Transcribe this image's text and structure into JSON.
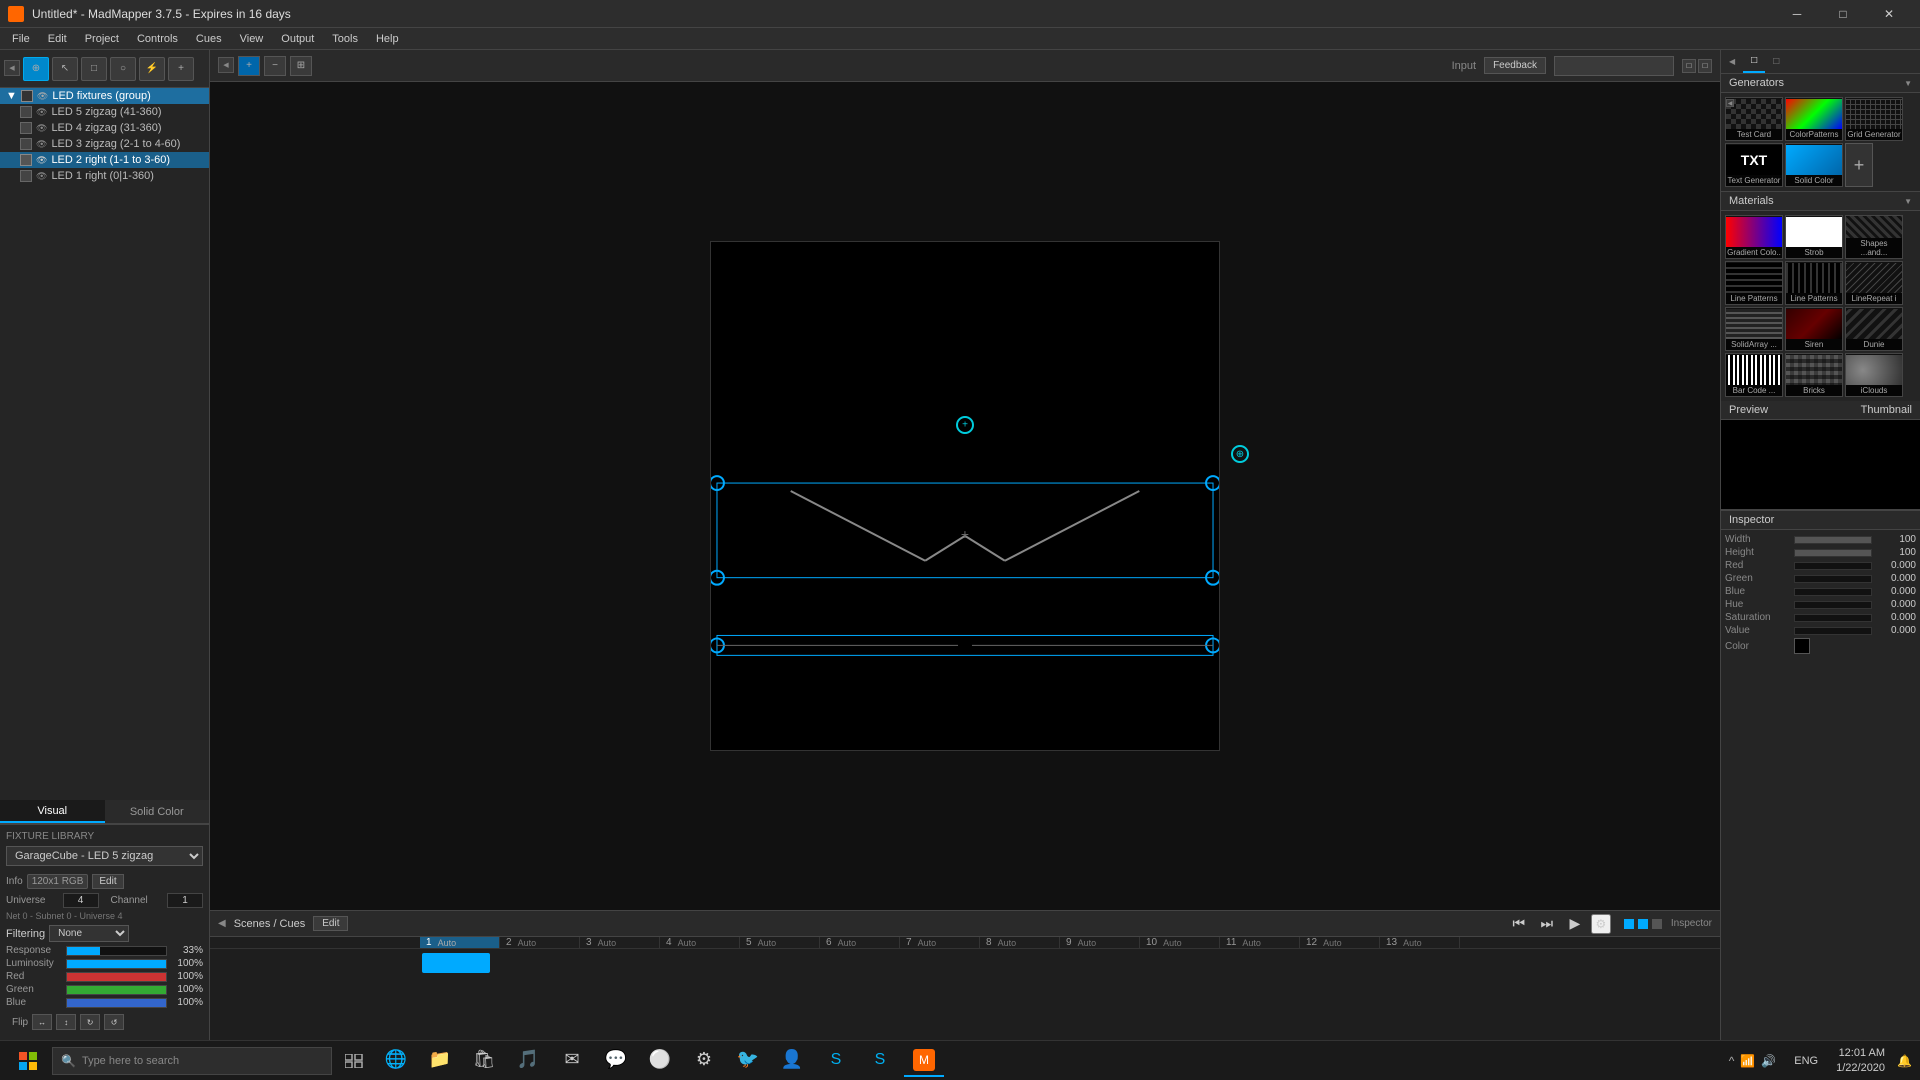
{
  "titlebar": {
    "title": "Untitled* - MadMapper 3.7.5 - Expires in 16 days",
    "icon": "★",
    "min_label": "─",
    "max_label": "□",
    "close_label": "✕"
  },
  "menubar": {
    "items": [
      "File",
      "Edit",
      "Project",
      "Controls",
      "Cues",
      "View",
      "Output",
      "Tools",
      "Help"
    ]
  },
  "toolbar": {
    "buttons": [
      "⚡",
      "□",
      "◎",
      "⚙",
      "⚡"
    ],
    "play_pause": "⏸",
    "stop": "⏹",
    "record": "⏺",
    "refresh": "↻"
  },
  "left_panel": {
    "scene_tree": {
      "group": "LED fixtures (group)",
      "items": [
        {
          "label": "LED 5 zigzag (41-360)",
          "selected": false
        },
        {
          "label": "LED 4 zigzag (31-360)",
          "selected": false
        },
        {
          "label": "LED 3 zigzag (2-1 to 4-60)",
          "selected": false
        },
        {
          "label": "LED 2 right (1-1 to 3-60)",
          "selected": true
        },
        {
          "label": "LED 1 right (0|1-360)",
          "selected": false
        }
      ]
    },
    "visual_tab": "Visual",
    "solid_color_tab": "Solid Color",
    "fixture_library": {
      "title": "Fixture Library",
      "dropdown": "GarageCube - LED 5 zigzag",
      "info_label": "Info",
      "info_value": "120x1 RGB",
      "edit_label": "Edit",
      "universe_label": "Universe",
      "universe_value": "4",
      "channel_label": "Channel",
      "channel_value": "1",
      "net_label": "Net 0 - Subnet 0 - Universe 4",
      "filtering_label": "Filtering",
      "filtering_value": "None",
      "response_label": "Response",
      "response_value": "33%",
      "luminosity_label": "Luminosity",
      "luminosity_value": "100%",
      "red_label": "Red",
      "red_value": "100%",
      "green_label": "Green",
      "green_value": "100%",
      "blue_label": "Blue",
      "blue_value": "100%",
      "flip_label": "Flip"
    }
  },
  "canvas": {
    "bg": "#000000"
  },
  "scenes": {
    "title": "Scenes / Cues",
    "edit_label": "Edit",
    "numbers": [
      "1",
      "2",
      "3",
      "4",
      "5",
      "6",
      "7",
      "8",
      "9",
      "10",
      "11",
      "12",
      "13"
    ],
    "auto_labels": [
      "Auto",
      "Auto",
      "Auto",
      "Auto",
      "Auto",
      "Auto",
      "Auto",
      "Auto",
      "Auto",
      "Auto",
      "Auto",
      "Auto",
      "Auto"
    ]
  },
  "right_panel": {
    "generators_title": "Generators",
    "thumbnails": [
      {
        "label": "Test Card",
        "type": "checkered"
      },
      {
        "label": "ColorPatterns",
        "type": "gradient"
      },
      {
        "label": "Grid Generator",
        "type": "grid"
      },
      {
        "label": "Text Generator",
        "type": "txt"
      },
      {
        "label": "Solid Color",
        "type": "solid"
      }
    ],
    "materials_title": "Materials",
    "material_thumbs": [
      {
        "label": "Gradient Colo..",
        "type": "gradient"
      },
      {
        "label": "Strob",
        "type": "strob"
      },
      {
        "label": "Shapes ...and ...",
        "type": "shapes"
      },
      {
        "label": "Line Patterns",
        "type": "linepatterns"
      },
      {
        "label": "Line Patterns",
        "type": "linepatterns2"
      },
      {
        "label": "LineRepeat i",
        "type": "linerepeat"
      },
      {
        "label": "SolidArray ...",
        "type": "solidarray"
      },
      {
        "label": "Siren",
        "type": "siren"
      },
      {
        "label": "Dunie",
        "type": "dunes"
      },
      {
        "label": "Bar Code ...",
        "type": "barcode"
      },
      {
        "label": "Bricks",
        "type": "bricks"
      },
      {
        "label": "iClouds",
        "type": "clouds"
      }
    ],
    "preview_title": "Preview",
    "thumbnail_label": "Thumbnail",
    "inspector_title": "Inspector",
    "width_label": "Width",
    "width_value": "100",
    "height_label": "Height",
    "height_value": "100",
    "red_label": "Red",
    "red_value": "0.000",
    "green_label": "Green",
    "green_value": "0.000",
    "blue_label": "Blue",
    "blue_value": "0.000",
    "hue_label": "Hue",
    "hue_value": "0.000",
    "saturation_label": "Saturation",
    "saturation_value": "0.000",
    "value_label": "Value",
    "value_value": "0.000",
    "color_label": "Color"
  },
  "taskbar": {
    "search_placeholder": "Type here to search",
    "time": "12:01 AM",
    "date": "1/22/2020",
    "lang": "ENG"
  },
  "input_label": "Input",
  "feedback_label": "Feedback"
}
